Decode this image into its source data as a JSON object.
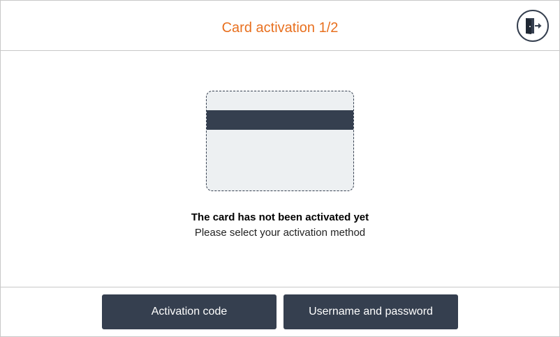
{
  "header": {
    "title": "Card activation 1/2",
    "logout_icon": "logout-door-icon"
  },
  "main": {
    "card_icon": "credit-card-icon",
    "message_title": "The card has not been activated yet",
    "message_subtitle": "Please select your activation method"
  },
  "footer": {
    "buttons": [
      {
        "label": "Activation code"
      },
      {
        "label": "Username and password"
      }
    ]
  },
  "colors": {
    "accent": "#e8701f",
    "primary_dark": "#353f4f",
    "card_fill": "#edf0f2",
    "divider": "#c8c8c8"
  }
}
